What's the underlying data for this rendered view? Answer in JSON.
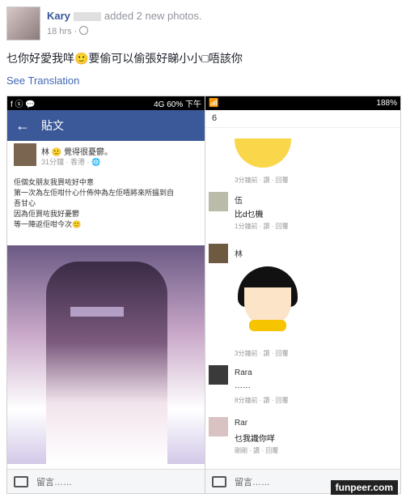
{
  "post": {
    "author": "Kary",
    "action": "added 2 new photos.",
    "time": "18 hrs ·",
    "status": "乜你好愛我咩🙂要偷可以偷張好睇小小□唔該你",
    "translate": "See Translation"
  },
  "left_phone": {
    "status_left": "f  ⓢ  💬",
    "status_right": "4G  60%  下午",
    "title": "貼文",
    "poster_name": "林 🙂 覺得很憂鬱。",
    "poster_time": "31分鐘 · 香港 · 🌐",
    "text_lines": [
      "佢個女朋友我買咗好中意",
      "第一次為左佢咁什心什佈仲為左佢唔將來所搵到自",
      "吾甘心",
      "因為佢買咗我好憂鬱",
      "等一陣返佢咁今次🙂"
    ],
    "comment_placeholder": "留言……"
  },
  "right_phone": {
    "status_right": "188%",
    "top_label": "6",
    "comments": [
      {
        "meta": "3分鐘前 · 讚 · 回覆"
      },
      {
        "name": "伍",
        "text": "比d乜機",
        "meta": "1分鐘前 · 讚 · 回覆"
      },
      {
        "name": "林",
        "meta": "3分鐘前 · 讚 · 回覆"
      },
      {
        "name": "Rara",
        "text": "……",
        "meta": "8分鐘前 · 讚 · 回覆"
      },
      {
        "name": "Rar",
        "text": "乜我識你咩",
        "meta": "剛剛 · 讚 · 回覆"
      }
    ],
    "comment_placeholder": "留言……"
  },
  "watermark": "funpeer.com"
}
